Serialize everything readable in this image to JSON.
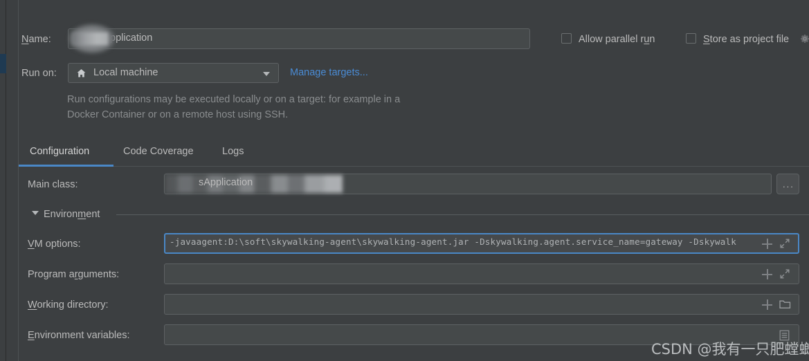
{
  "form": {
    "name_label": "Name:",
    "name_label_mnemonic": "N",
    "name_value": "pplication",
    "name_redacted": true,
    "run_on_label": "Run on:",
    "run_on_value": "Local machine",
    "run_on_icon": "home-icon",
    "manage_targets_link": "Manage targets...",
    "description": "Run configurations may be executed locally or on a target: for example in a Docker Container or on a remote host using SSH."
  },
  "checkboxes": [
    {
      "label": "Allow parallel run",
      "mnemonic": "u",
      "checked": false
    },
    {
      "label": "Store as project file",
      "mnemonic": "S",
      "checked": false
    }
  ],
  "tabs": [
    {
      "label": "Configuration",
      "active": true
    },
    {
      "label": "Code Coverage",
      "active": false
    },
    {
      "label": "Logs",
      "active": false
    }
  ],
  "main_class": {
    "label": "Main class:",
    "value": "sApplication",
    "redacted": true,
    "browse_button": "...",
    "browse_icon": "ellipsis-icon"
  },
  "environment": {
    "group_label": "Environment",
    "group_mnemonic": "m",
    "expanded": true,
    "fields": [
      {
        "label": "VM options:",
        "mnemonic": "V",
        "value": "-javaagent:D:\\soft\\skywalking-agent\\skywalking-agent.jar -Dskywalking.agent.service_name=gateway -Dskywalk",
        "focused": true,
        "icons": [
          "plus-icon",
          "expand-icon"
        ]
      },
      {
        "label": "Program arguments:",
        "mnemonic": "r",
        "value": "",
        "focused": false,
        "icons": [
          "plus-icon",
          "expand-icon"
        ]
      },
      {
        "label": "Working directory:",
        "mnemonic": "W",
        "value": "",
        "focused": false,
        "icons": [
          "plus-icon",
          "folder-icon"
        ]
      },
      {
        "label": "Environment variables:",
        "mnemonic": "E",
        "value": "",
        "focused": false,
        "icons": [
          "list-icon"
        ]
      }
    ]
  },
  "watermark": "CSDN @我有一只肥螳螂",
  "colors": {
    "background": "#3c3f41",
    "field_background": "#45494a",
    "border": "#5e6264",
    "accent_blue": "#4a88c7",
    "link_blue": "#4a8bd4",
    "text": "#bbbbbb",
    "muted_text": "#8a8d8f",
    "selection": "#1f3a52"
  }
}
